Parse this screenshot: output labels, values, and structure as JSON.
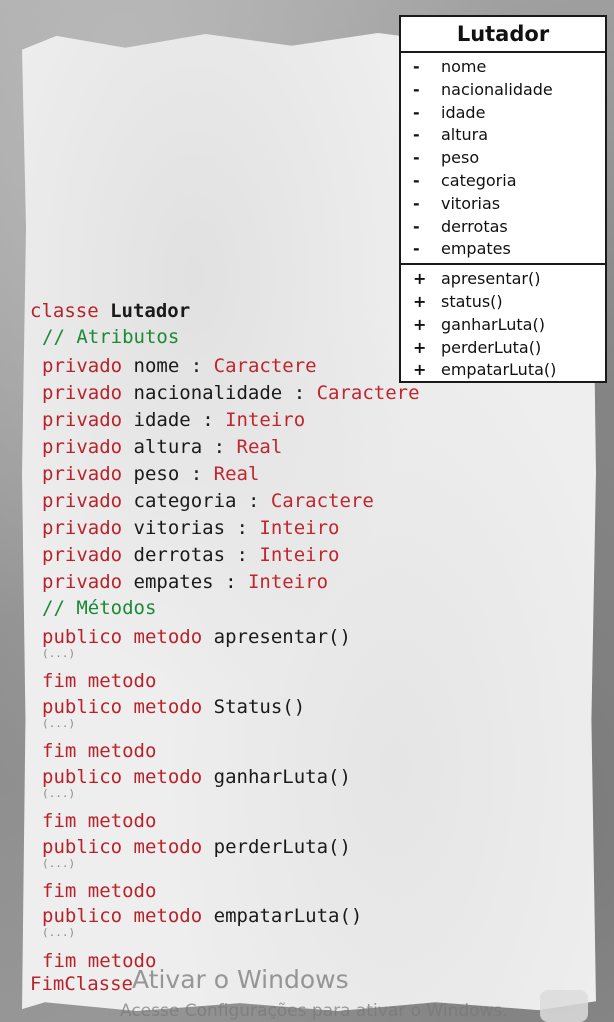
{
  "uml": {
    "title": "Lutador",
    "attributes": [
      {
        "visibility": "-",
        "name": "nome"
      },
      {
        "visibility": "-",
        "name": "nacionalidade"
      },
      {
        "visibility": "-",
        "name": "idade"
      },
      {
        "visibility": "-",
        "name": "altura"
      },
      {
        "visibility": "-",
        "name": "peso"
      },
      {
        "visibility": "-",
        "name": "categoria"
      },
      {
        "visibility": "-",
        "name": "vitorias"
      },
      {
        "visibility": "-",
        "name": "derrotas"
      },
      {
        "visibility": "-",
        "name": "empates"
      }
    ],
    "methods": [
      {
        "visibility": "+",
        "name": "apresentar()"
      },
      {
        "visibility": "+",
        "name": "status()"
      },
      {
        "visibility": "+",
        "name": "ganharLuta()"
      },
      {
        "visibility": "+",
        "name": "perderLuta()"
      },
      {
        "visibility": "+",
        "name": "empatarLuta()"
      }
    ]
  },
  "code": {
    "class_keyword": "classe",
    "class_name": "Lutador",
    "comment_attrs": "// Atributos",
    "attributes": [
      {
        "mod": "privado",
        "name": "nome",
        "sep": ":",
        "type": "Caractere"
      },
      {
        "mod": "privado",
        "name": "nacionalidade",
        "sep": ":",
        "type": "Caractere"
      },
      {
        "mod": "privado",
        "name": "idade",
        "sep": ":",
        "type": "Inteiro"
      },
      {
        "mod": "privado",
        "name": "altura",
        "sep": ":",
        "type": "Real"
      },
      {
        "mod": "privado",
        "name": "peso",
        "sep": ":",
        "type": "Real"
      },
      {
        "mod": "privado",
        "name": "categoria",
        "sep": ":",
        "type": "Caractere"
      },
      {
        "mod": "privado",
        "name": "vitorias",
        "sep": ":",
        "type": "Inteiro"
      },
      {
        "mod": "privado",
        "name": "derrotas",
        "sep": ":",
        "type": "Inteiro"
      },
      {
        "mod": "privado",
        "name": "empates",
        "sep": ":",
        "type": "Inteiro"
      }
    ],
    "comment_methods": "// Métodos",
    "methods": [
      {
        "mod": "publico",
        "kw": "metodo",
        "name": "apresentar()",
        "body": "(...)",
        "end": "fim metodo"
      },
      {
        "mod": "publico",
        "kw": "metodo",
        "name": "Status()",
        "body": "(...)",
        "end": "fim metodo"
      },
      {
        "mod": "publico",
        "kw": "metodo",
        "name": "ganharLuta()",
        "body": "(...)",
        "end": "fim metodo"
      },
      {
        "mod": "publico",
        "kw": "metodo",
        "name": "perderLuta()",
        "body": "(...)",
        "end": "fim metodo"
      },
      {
        "mod": "publico",
        "kw": "metodo",
        "name": "empatarLuta()",
        "body": "(...)",
        "end": "fim metodo"
      }
    ],
    "end_class": "FimClasse"
  },
  "watermark": {
    "title": "Ativar o Windows",
    "subtitle": "Acesse Configurações para ativar o Windows."
  },
  "colors": {
    "keyword": "#b8232b",
    "comment": "#1c8a35",
    "type": "#c0262e",
    "text": "#1a1a1a"
  }
}
